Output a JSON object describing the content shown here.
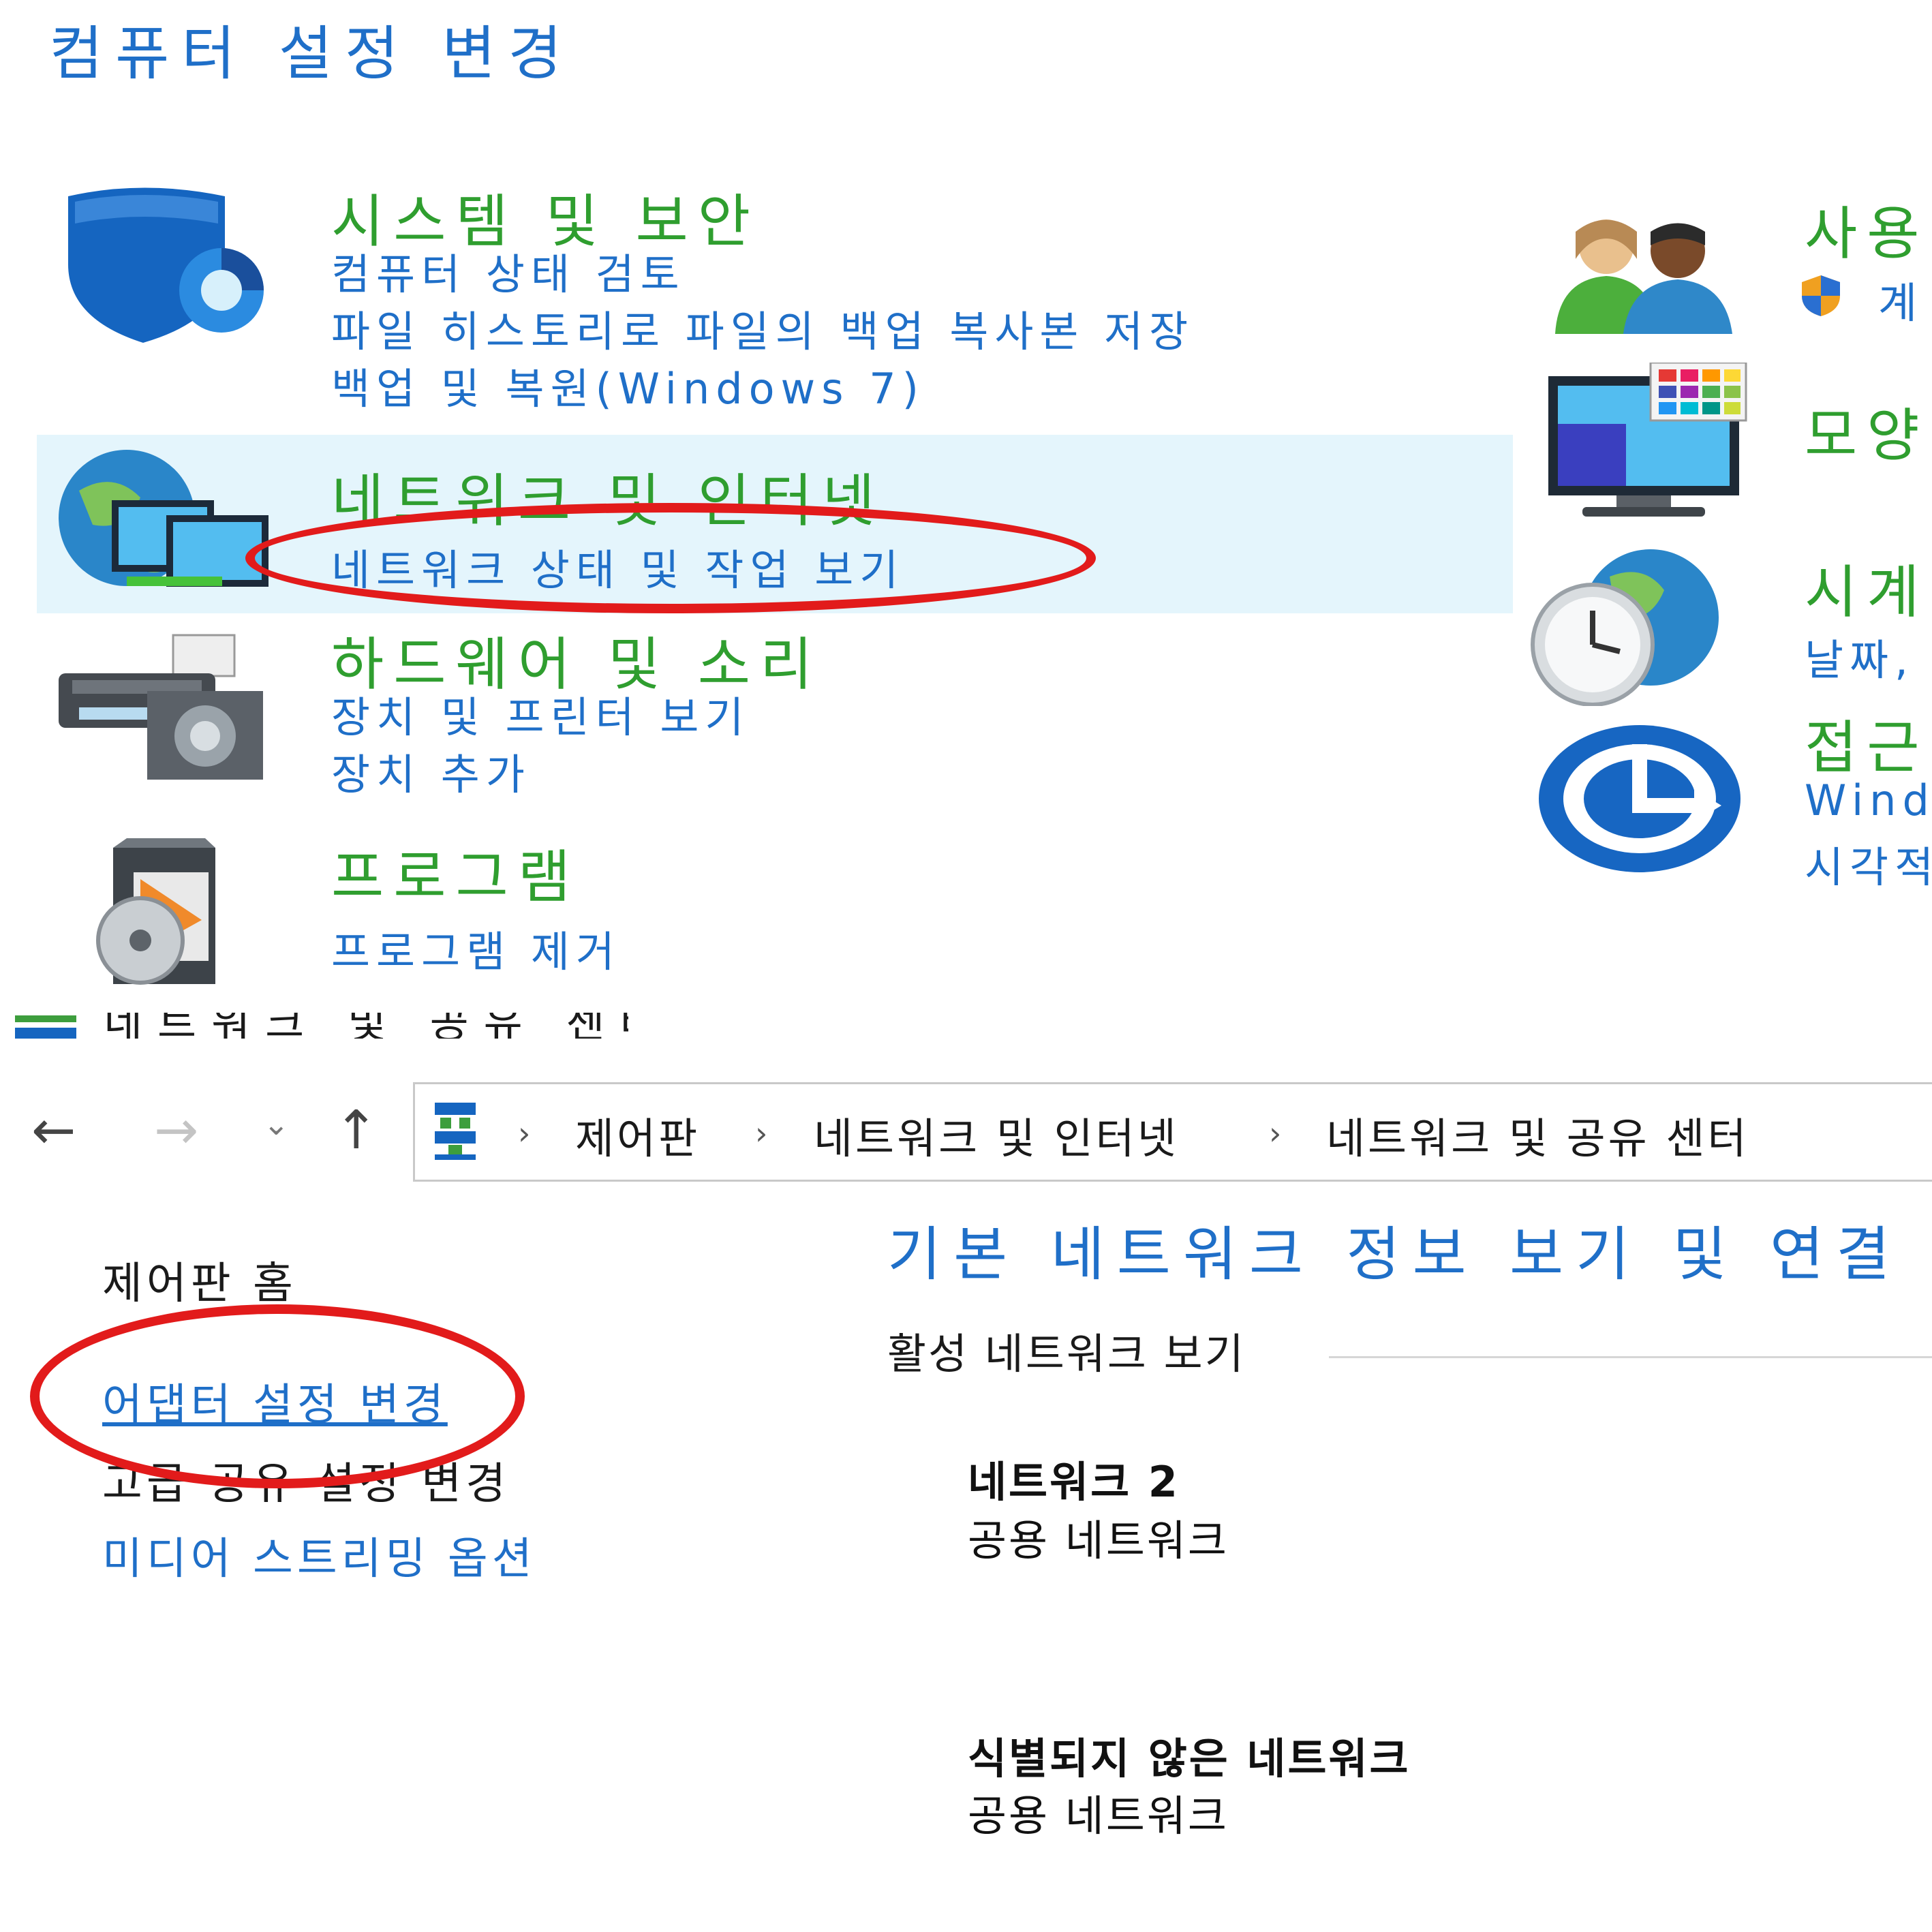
{
  "page_title": "컴퓨터 설정 변경",
  "categories": {
    "system": {
      "title": "시스템 및 보안",
      "links": [
        "컴퓨터 상태 검토",
        "파일 히스토리로 파일의 백업 복사본 저장",
        "백업 및 복원(Windows 7)"
      ]
    },
    "network": {
      "title": "네트워크 및 인터넷",
      "links": [
        "네트워크 상태 및 작업 보기"
      ]
    },
    "hardware": {
      "title": "하드웨어 및 소리",
      "links": [
        "장치 및 프린터 보기",
        "장치 추가"
      ]
    },
    "programs": {
      "title": "프로그램",
      "links": [
        "프로그램 제거"
      ]
    },
    "users": {
      "title": "사용",
      "links": [
        "계"
      ]
    },
    "appearance": {
      "title": "모양"
    },
    "clock": {
      "title": "시계",
      "links": [
        "날짜,"
      ]
    },
    "ease": {
      "title": "접근",
      "links": [
        "Wind",
        "시각적"
      ]
    }
  },
  "cut_text": "네트워크 및 공유 센터",
  "breadcrumb": {
    "items": [
      "제어판",
      "네트워크 및 인터넷",
      "네트워크 및 공유 센터"
    ]
  },
  "sidebar": {
    "home": "제어판 홈",
    "adapter": "어댑터 설정 변경",
    "advanced": "고급 공유 설정 변경",
    "media": "미디어 스트리밍 옵션"
  },
  "main": {
    "title": "기본 네트워크 정보 보기 및 연결 설",
    "section": "활성 네트워크 보기",
    "networks": [
      {
        "name": "네트워크 2",
        "type": "공용 네트워크"
      },
      {
        "name": "식별되지 않은 네트워크",
        "type": "공용 네트워크"
      }
    ]
  },
  "colors": {
    "link_blue": "#1f6fc8",
    "category_green": "#2f9e2f",
    "highlight": "#e4f5fc",
    "annotation_red": "#e21b1b"
  },
  "icons": [
    "shield-icon",
    "network-globe-icon",
    "printer-icon",
    "programs-box-icon",
    "users-icon",
    "monitor-palette-icon",
    "clock-globe-icon",
    "ease-of-access-icon",
    "control-panel-icon",
    "back-arrow-icon",
    "forward-arrow-icon",
    "recent-chevron-icon",
    "up-arrow-icon"
  ]
}
